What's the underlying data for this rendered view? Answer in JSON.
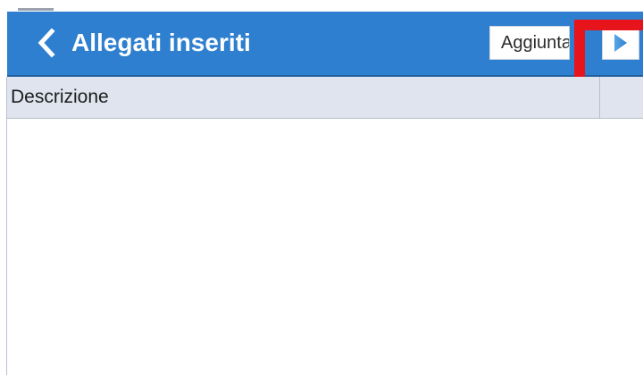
{
  "header": {
    "title": "Allegati inseriti",
    "back_icon": "chevron-left-icon",
    "add_label": "Aggiunta",
    "next_icon": "play-triangle-icon",
    "bar_color": "#2e7fcf"
  },
  "table": {
    "columns": [
      "Descrizione"
    ],
    "rows": []
  },
  "annotation": {
    "highlight_color": "#e8141c"
  }
}
